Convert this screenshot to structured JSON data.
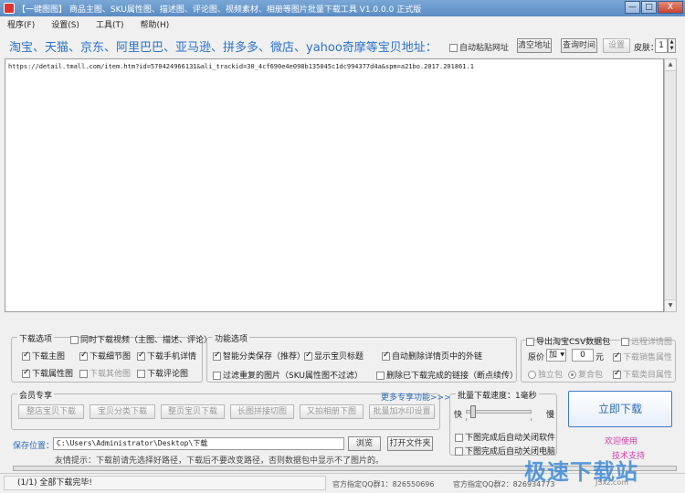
{
  "window": {
    "title": "【一键图图】 商品主图、SKU属性图、描述图、评论图、视频素材、相册等图片批量下载工具 V1.0.0.0 正式版",
    "minimize": "—",
    "maximize": "□",
    "close": "X"
  },
  "menu": [
    "程序(F)",
    "设置(S)",
    "工具(T)",
    "帮助(H)"
  ],
  "address": {
    "title": "淘宝、天猫、京东、阿里巴巴、亚马逊、拼多多、微店、yahoo奇摩等宝贝地址：",
    "auto_paste": "自动粘贴网址",
    "clear_btn": "清空地址",
    "query_btn": "查询时间",
    "settings_btn": "设置",
    "skin_label": "皮肤：",
    "skin_value": "1",
    "url_text": "https://detail.tmall.com/item.htm?id=570424966131&ali_trackid=30_4cf690e4e098b135045c1dc994377d4a&spm=a21bo.2017.201861.1"
  },
  "download_options": {
    "title": "下载选项",
    "video": "同时下载视频（主图、描述、评论）",
    "main_img": "下载主图",
    "detail_img": "下载细节图",
    "mobile_detail": "下载手机详情",
    "attr_img": "下载属性图",
    "other_img": "下载其他图",
    "review_img": "下载评论图"
  },
  "func_options": {
    "title": "功能选项",
    "smart_save": "智能分类保存（推荐）",
    "show_title": "显示宝贝标题",
    "auto_delete": "自动删除详情页中的外链",
    "filter_dup": "过滤重复的图片（SKU属性图不过滤）",
    "delete_done": "删除已下载完成的链接（断点续传）"
  },
  "csv_options": {
    "export_csv": "导出淘宝CSV数据包",
    "remote_detail": "远程详情图",
    "price_label": "原价",
    "price_op": "加",
    "price_value": "0",
    "price_unit": "元",
    "sales_attr": "下载销售属性",
    "single_pkg": "独立包",
    "merge_pkg": "复合包",
    "custom_attr": "下载类目属性"
  },
  "vip": {
    "title": "会员专享",
    "more": "更多专享功能>>>",
    "buttons": [
      "整店宝贝下载",
      "宝贝分类下载",
      "整页宝贝下载",
      "长图拼接切图",
      "又拍相册下图",
      "批量加水印设置"
    ]
  },
  "speed": {
    "title": "批量下载速度：1毫秒",
    "fast": "快",
    "slow": "慢",
    "shutdown_after": "下图完成后自动关闭软件",
    "poweroff_after": "下图完成后自动关闭电脑"
  },
  "actions": {
    "download": "立即下载",
    "welcome": "欢迎使用",
    "support": "技术支持"
  },
  "save": {
    "label": "保存位置：",
    "path": "C:\\Users\\Administrator\\Desktop\\下载",
    "browse": "浏览",
    "open_folder": "打开文件夹",
    "tip": "友情提示：下载前请先选择好路径，下载后不要改变路径，否则数据包中显示不了图片的。"
  },
  "status": {
    "left": "(1/1) 全部下载完毕!",
    "qq1": "官方指定QQ群1：826550696",
    "qq2": "官方指定QQ群2：826934773",
    "company": "福建厦门一大鸟工作室"
  },
  "watermark": {
    "text": "极速下载站",
    "sub": "JSxz.com"
  }
}
